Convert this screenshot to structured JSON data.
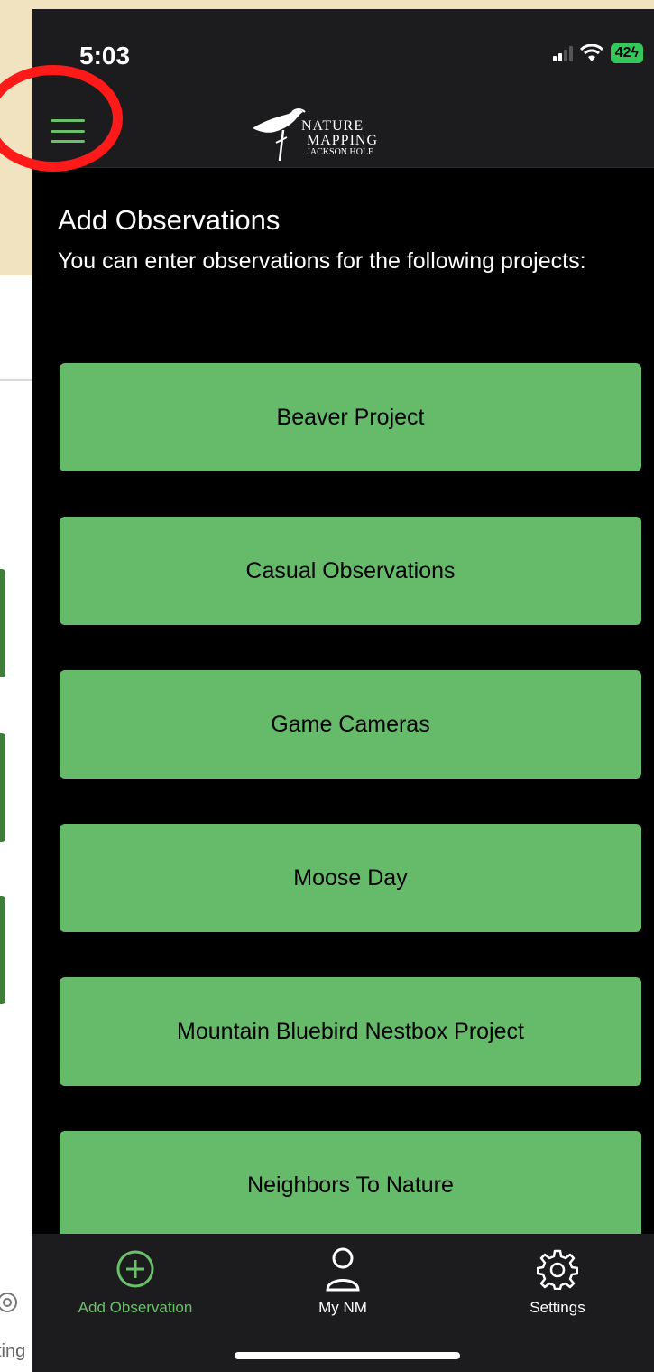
{
  "status_bar": {
    "time": "5:03",
    "battery": "42"
  },
  "header": {
    "logo_line1": "NATURE",
    "logo_line2": "MAPPING",
    "logo_line3": "JACKSON HOLE"
  },
  "main": {
    "title": "Add Observations",
    "subtitle": "You can enter observations for the following projects:",
    "projects": [
      {
        "label": "Beaver Project"
      },
      {
        "label": "Casual Observations"
      },
      {
        "label": "Game Cameras"
      },
      {
        "label": "Moose Day"
      },
      {
        "label": "Mountain Bluebird Nestbox Project"
      },
      {
        "label": "Neighbors To Nature"
      }
    ]
  },
  "tab_bar": {
    "items": [
      {
        "label": "Add Observation",
        "icon": "plus-circle-icon",
        "active": true
      },
      {
        "label": "My NM",
        "icon": "person-icon",
        "active": false
      },
      {
        "label": "Settings",
        "icon": "gear-icon",
        "active": false
      }
    ]
  },
  "background_page": {
    "settings_label": "ting"
  },
  "colors": {
    "accent": "#66bb6a",
    "active_tab": "#6abf69",
    "highlight": "#ff1a1a",
    "screen_bg": "#000000",
    "bar_bg": "#1c1c1e"
  }
}
